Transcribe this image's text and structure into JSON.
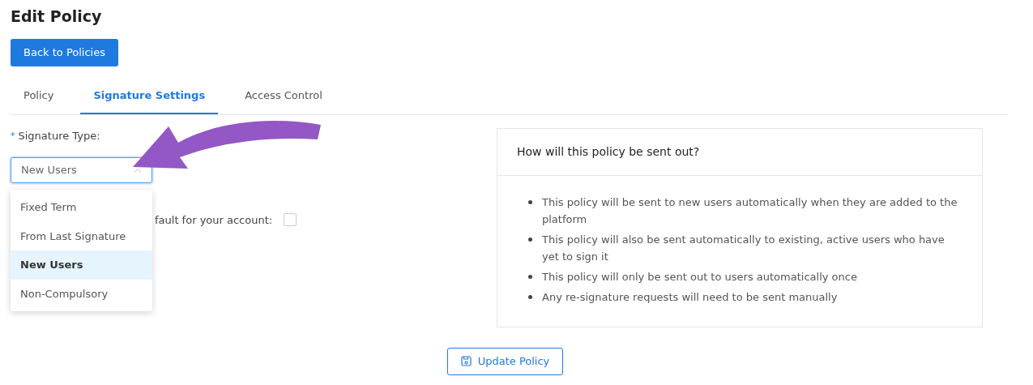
{
  "title": "Edit Policy",
  "back_button": "Back to Policies",
  "tabs": [
    {
      "label": "Policy",
      "selected": false
    },
    {
      "label": "Signature Settings",
      "selected": true
    },
    {
      "label": "Access Control",
      "selected": false
    }
  ],
  "signature_type": {
    "required_mark": "*",
    "label": "Signature Type:",
    "value": "New Users",
    "expanded": true,
    "options": [
      {
        "label": "Fixed Term",
        "selected": false
      },
      {
        "label": "From Last Signature",
        "selected": false
      },
      {
        "label": "New Users",
        "selected": true
      },
      {
        "label": "Non-Compulsory",
        "selected": false
      }
    ]
  },
  "default_setting": {
    "label": "fault for your account:",
    "checked": false
  },
  "info_card": {
    "title": "How will this policy be sent out?",
    "bullets": [
      "This policy will be sent to new users automatically when they are added to the platform",
      "This policy will also be sent automatically to existing, active users who have yet to sign it",
      "This policy will only be sent out to users automatically once",
      "Any re-signature requests will need to be sent manually"
    ]
  },
  "update_button": "Update Policy"
}
